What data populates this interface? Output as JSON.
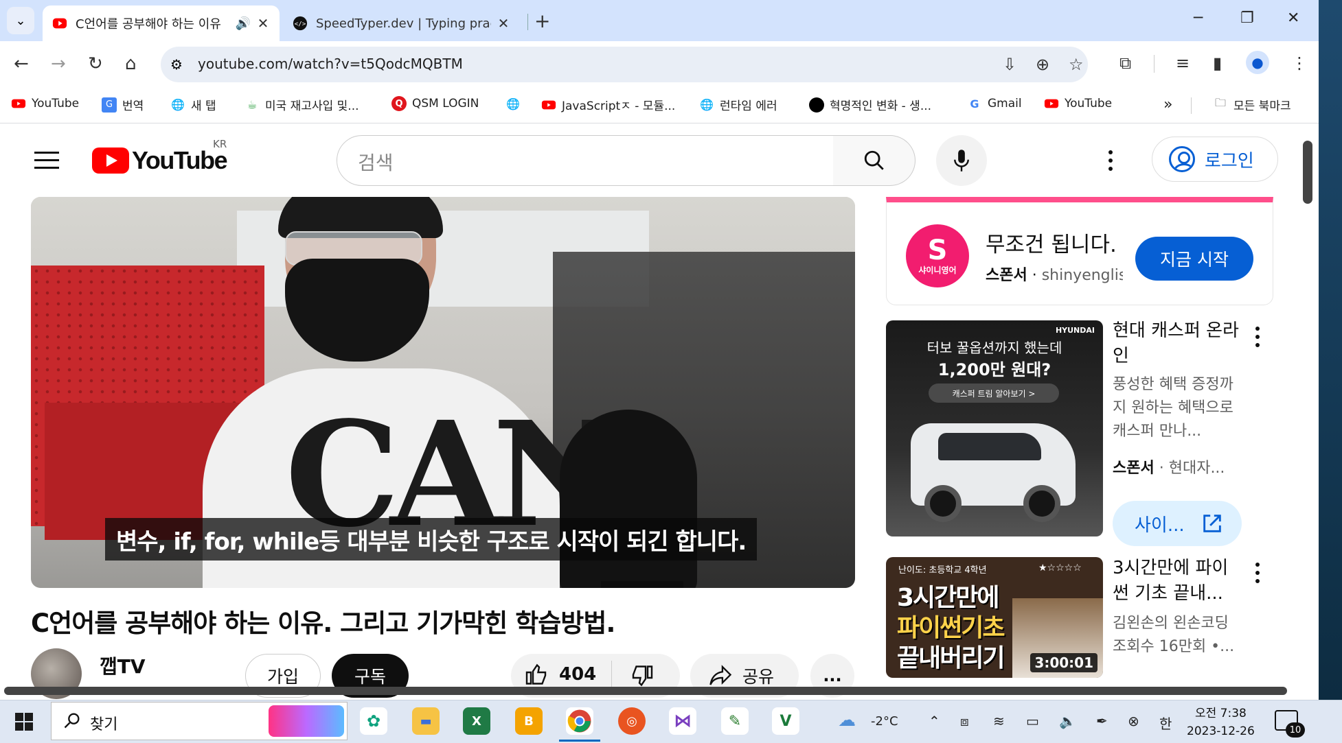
{
  "browser": {
    "tabs": [
      {
        "title": "C언어를 공부해야 하는 이유",
        "favicon": "youtube-icon",
        "active": true,
        "audio": true
      },
      {
        "title": "SpeedTyper.dev | Typing practi",
        "favicon": "code-icon",
        "active": false
      }
    ],
    "new_tab_label": "+",
    "url": "youtube.com/watch?v=t5QodcMQBTM",
    "window_controls": {
      "minimize": "─",
      "restore": "❐",
      "close": "✕"
    }
  },
  "bookmarks": {
    "items": [
      {
        "label": "YouTube",
        "icon": "youtube-icon"
      },
      {
        "label": "번역",
        "icon": "translate-icon"
      },
      {
        "label": "새 탭",
        "icon": "globe-icon"
      },
      {
        "label": "미국 재고사입 및...",
        "icon": "cup-icon"
      },
      {
        "label": "QSM LOGIN",
        "icon": "qsm-icon"
      },
      {
        "label": "",
        "icon": "globe-icon"
      },
      {
        "label": "JavaScriptㅈ - 모듈...",
        "icon": "youtube-icon"
      },
      {
        "label": "런타임 에러",
        "icon": "globe-icon"
      },
      {
        "label": "혁명적인 변화 - 생...",
        "icon": "circle-icon"
      },
      {
        "label": "Gmail",
        "icon": "google-icon"
      },
      {
        "label": "YouTube",
        "icon": "youtube-icon"
      }
    ],
    "overflow": "»",
    "all_bookmarks": "모든 북마크"
  },
  "youtube": {
    "logo_text": "YouTube",
    "region": "KR",
    "search_placeholder": "검색",
    "login_label": "로그인",
    "video": {
      "caption": "변수, if, for, while등 대부분 비슷한 구조로 시작이 되긴 합니다.",
      "shirt_print": "CAN"
    },
    "title": "C언어를 공부해야 하는 이유. 그리고 기가막힌 학습방법.",
    "channel": "깹TV",
    "join_label": "가입",
    "subscribe_label": "구독",
    "likes": "404",
    "share_label": "공유",
    "more_label": "..."
  },
  "sidebar": {
    "ad": {
      "logo_text": "샤이니영어",
      "title": "무조건 됩니다.",
      "sponsor_label": "스폰서",
      "domain": "shinyenglish",
      "cta": "지금 시작"
    },
    "hyundai": {
      "brand": "HYUNDAI",
      "thumb_line1": "터보 꿀옵션까지 했는데",
      "thumb_line2": "1,200만 원대?",
      "thumb_pill": "캐스퍼 트림 알아보기 >",
      "title": "현대 캐스퍼 온라인",
      "desc": "풍성한 혜택 증정까지 원하는 혜택으로 캐스퍼 만나...",
      "sponsor_label": "스폰서",
      "advertiser": "현대자...",
      "cta": "사이..."
    },
    "python": {
      "thumb_top": "난이도: 초등학교 4학년",
      "thumb_stars": "★☆☆☆☆",
      "thumb_line1": "3시간만에",
      "thumb_line2": "파이썬기초",
      "thumb_line3": "끝내버리기",
      "duration": "3:00:01",
      "title": "3시간만에 파이썬 기초 끝내...",
      "channel": "김왼손의 왼손코딩",
      "views": "조회수 16만회 •..."
    }
  },
  "taskbar": {
    "search_label": "찾기",
    "weather": "-2°C",
    "ime": "한",
    "time": "오전 7:38",
    "date": "2023-12-26",
    "notifications": "10"
  },
  "colors": {
    "youtube_red": "#ff0000",
    "link_blue": "#065fd4",
    "ad_pink": "#ff4e8b"
  }
}
